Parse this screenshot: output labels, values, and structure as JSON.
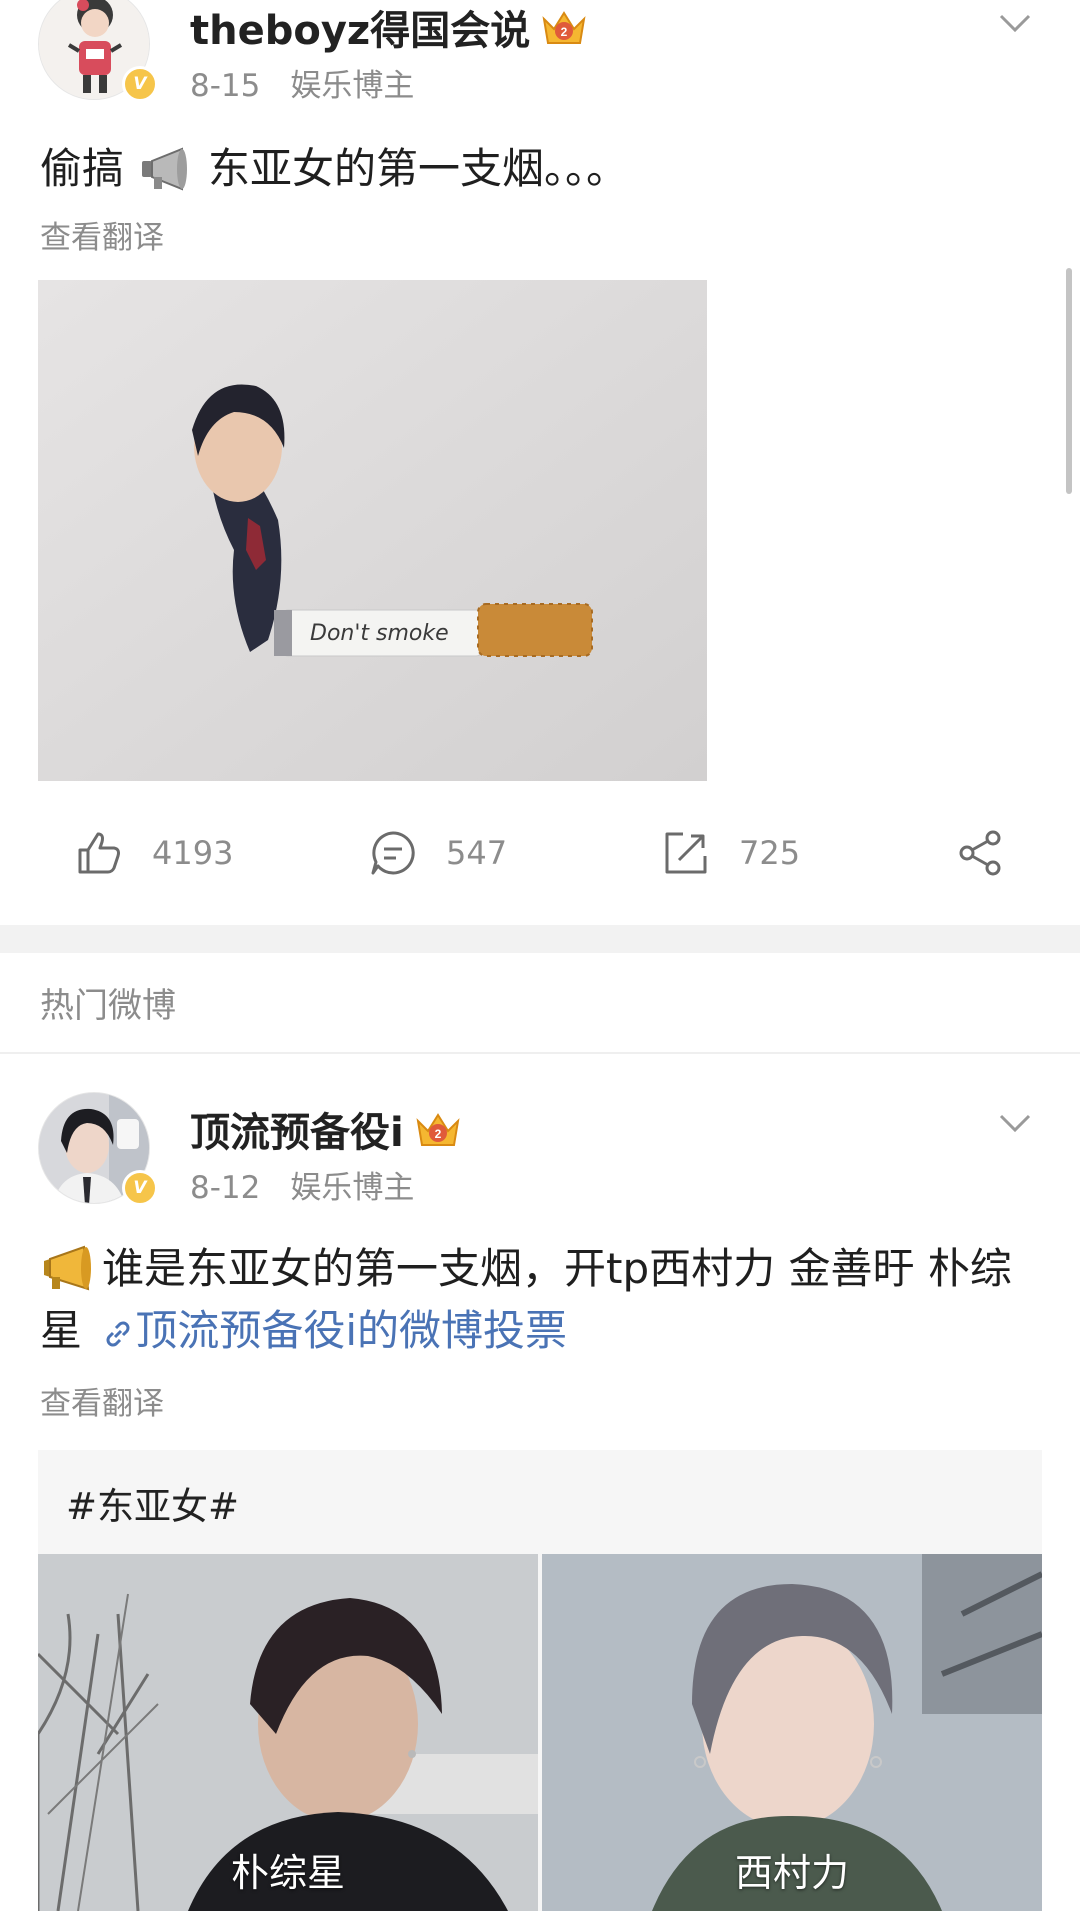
{
  "post1": {
    "username": "theboyz得国会说",
    "date": "8-15",
    "category": "娱乐博主",
    "text_before": "偷搞",
    "text_after": "东亚女的第一支烟。。。",
    "translate": "查看翻译",
    "image_caption": "Don't smoke",
    "likes": "4193",
    "comments": "547",
    "reposts": "725",
    "crown_badge": "2"
  },
  "section": {
    "title": "热门微博"
  },
  "post2": {
    "username": "顶流预备役i",
    "date": "8-12",
    "category": "娱乐博主",
    "text_main": "谁是东亚女的第一支烟，开tp西村力 金善旴 朴综星",
    "link_text": "顶流预备役i的微博投票",
    "translate": "查看翻译",
    "crown_badge": "2",
    "vote": {
      "topic": "#东亚女#",
      "options": [
        {
          "label": "朴综星"
        },
        {
          "label": "西村力"
        }
      ]
    }
  },
  "colors": {
    "link": "#4a73b5",
    "vip_badge": "#f6c54a",
    "divider": "#f2f2f2",
    "secondary_text": "#8c8c8c"
  },
  "icons": [
    "chevron-down-icon",
    "crown-icon",
    "verified-icon",
    "megaphone-icon",
    "like-icon",
    "comment-icon",
    "repost-icon",
    "share-icon",
    "link-icon"
  ]
}
